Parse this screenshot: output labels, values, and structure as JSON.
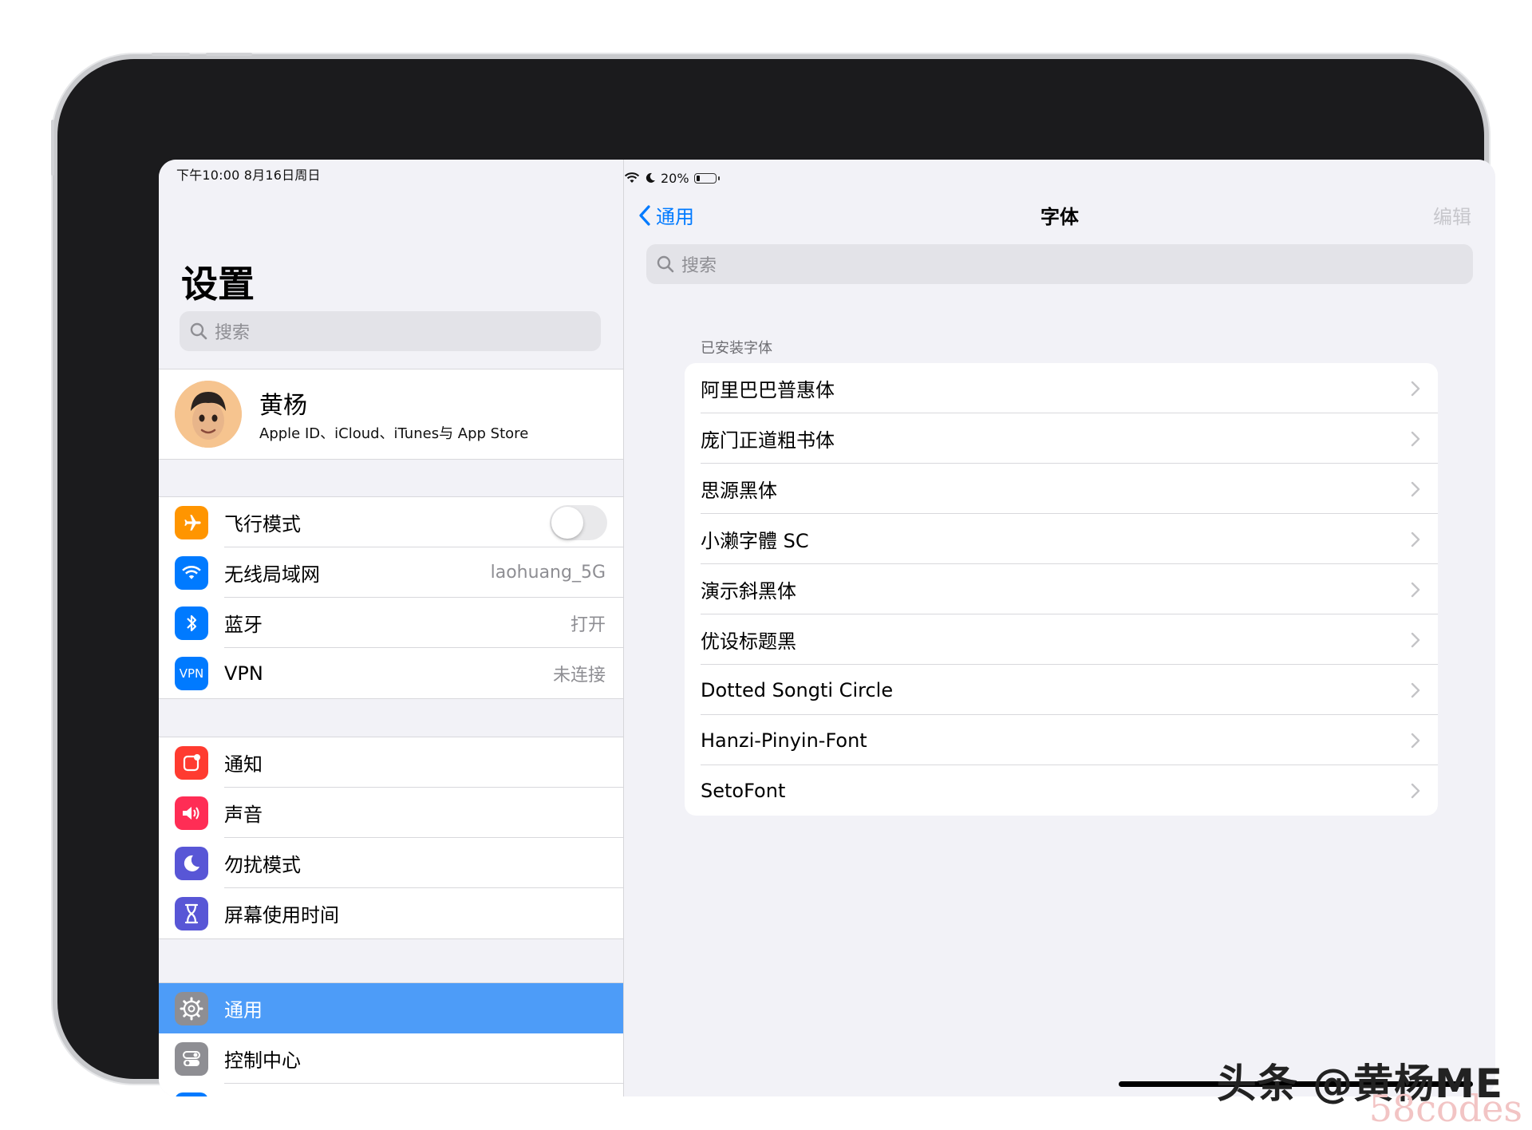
{
  "status_bar": {
    "time": "下午10:00   8月16日周日",
    "battery": "20%",
    "battery_level": 0.2
  },
  "sidebar": {
    "title": "设置",
    "search_placeholder": "搜索",
    "profile": {
      "name": "黄杨",
      "subtitle": "Apple ID、iCloud、iTunes与 App Store"
    },
    "group1": [
      {
        "label": "飞行模式",
        "icon": "airplane-icon",
        "color": "#ff9500",
        "toggle": false
      },
      {
        "label": "无线局域网",
        "value": "laohuang_5G",
        "icon": "wifi-icon",
        "color": "#007aff"
      },
      {
        "label": "蓝牙",
        "value": "打开",
        "icon": "bluetooth-icon",
        "color": "#007aff"
      },
      {
        "label": "VPN",
        "value": "未连接",
        "icon_text": "VPN",
        "icon": "vpn-icon",
        "color": "#007aff"
      }
    ],
    "group2": [
      {
        "label": "通知",
        "icon": "notifications-icon",
        "color": "#ff3b30"
      },
      {
        "label": "声音",
        "icon": "sound-icon",
        "color": "#ff2d55"
      },
      {
        "label": "勿扰模式",
        "icon": "moon-icon",
        "color": "#5856d6"
      },
      {
        "label": "屏幕使用时间",
        "icon": "hourglass-icon",
        "color": "#5856d6"
      }
    ],
    "group3": [
      {
        "label": "通用",
        "icon": "gear-icon",
        "color": "#8e8e93",
        "selected": true
      },
      {
        "label": "控制中心",
        "icon": "control-center-icon",
        "color": "#8e8e93"
      }
    ]
  },
  "detail": {
    "back_label": "通用",
    "title": "字体",
    "edit_label": "编辑",
    "search_placeholder": "搜索",
    "section_header": "已安装字体",
    "fonts": [
      "阿里巴巴普惠体",
      "庞门正道粗书体",
      "思源黑体",
      "小濑字體 SC",
      "演示斜黑体",
      "优设标题黑",
      "Dotted Songti Circle",
      "Hanzi-Pinyin-Font",
      "SetoFont"
    ]
  },
  "watermark": {
    "text": "头条 @黄杨ME",
    "site": "58codes"
  },
  "colors": {
    "accent": "#007aff",
    "selected_row": "#4d9cf8",
    "background": "#f2f2f7"
  }
}
